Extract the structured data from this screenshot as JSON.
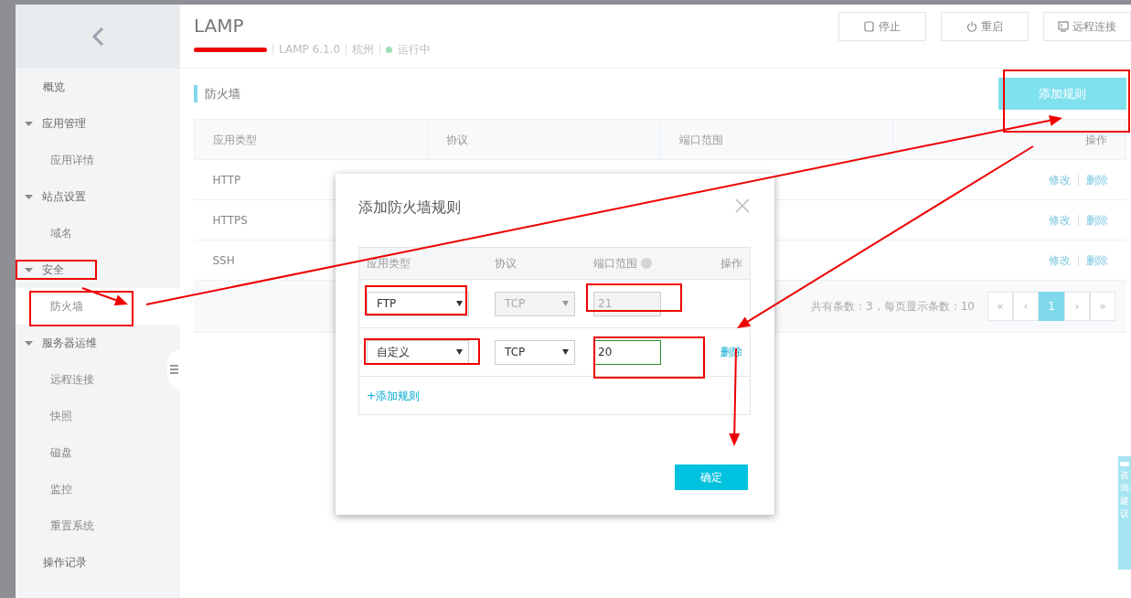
{
  "sidebar": {
    "items": [
      {
        "kind": "link",
        "label": "概览",
        "selected": false
      },
      {
        "kind": "group",
        "label": "应用管理",
        "expanded": true,
        "children": [
          {
            "label": "应用详情",
            "selected": false
          }
        ]
      },
      {
        "kind": "group",
        "label": "站点设置",
        "expanded": true,
        "children": [
          {
            "label": "域名",
            "selected": false
          }
        ]
      },
      {
        "kind": "group",
        "label": "安全",
        "expanded": true,
        "children": [
          {
            "label": "防火墙",
            "selected": true
          }
        ]
      },
      {
        "kind": "group",
        "label": "服务器运维",
        "expanded": true,
        "children": [
          {
            "label": "远程连接",
            "selected": false
          },
          {
            "label": "快照",
            "selected": false
          },
          {
            "label": "磁盘",
            "selected": false
          },
          {
            "label": "监控",
            "selected": false
          },
          {
            "label": "重置系统",
            "selected": false
          }
        ]
      },
      {
        "kind": "link",
        "label": "操作记录",
        "selected": false
      }
    ]
  },
  "header": {
    "title": "LAMP",
    "meta": [
      "LAMP 6.1.0",
      "杭州"
    ],
    "status": "运行中",
    "actions": [
      {
        "label": "停止"
      },
      {
        "label": "重启"
      },
      {
        "label": "远程连接"
      }
    ]
  },
  "section": {
    "title": "防火墙",
    "add_button": "添加规则"
  },
  "table": {
    "columns": [
      "应用类型",
      "协议",
      "端口范围",
      "操作"
    ],
    "rows": [
      {
        "app_type": "HTTP",
        "actions": [
          "修改",
          "删除"
        ]
      },
      {
        "app_type": "HTTPS",
        "actions": [
          "修改",
          "删除"
        ]
      },
      {
        "app_type": "SSH",
        "actions": [
          "修改",
          "删除"
        ]
      }
    ],
    "pagination": {
      "summary": "共有条数：3，每页显示条数：10",
      "pages": [
        {
          "label": "«",
          "selected": false
        },
        {
          "label": "‹",
          "selected": false
        },
        {
          "label": "1",
          "selected": true
        },
        {
          "label": "›",
          "selected": false
        },
        {
          "label": "»",
          "selected": false
        }
      ]
    }
  },
  "modal": {
    "title": "添加防火墙规则",
    "columns": [
      "应用类型",
      "协议",
      "端口范围",
      "操作"
    ],
    "rows": [
      {
        "app_type": "FTP",
        "protocol": "TCP",
        "port": "21",
        "disabled": true,
        "focused": false
      },
      {
        "app_type": "自定义",
        "protocol": "TCP",
        "port": "20",
        "disabled": false,
        "focused": true,
        "action": "删除"
      }
    ],
    "add_link": "+添加规则",
    "confirm": "确定"
  },
  "feedback_tab": {
    "label": "咨询-建议"
  }
}
